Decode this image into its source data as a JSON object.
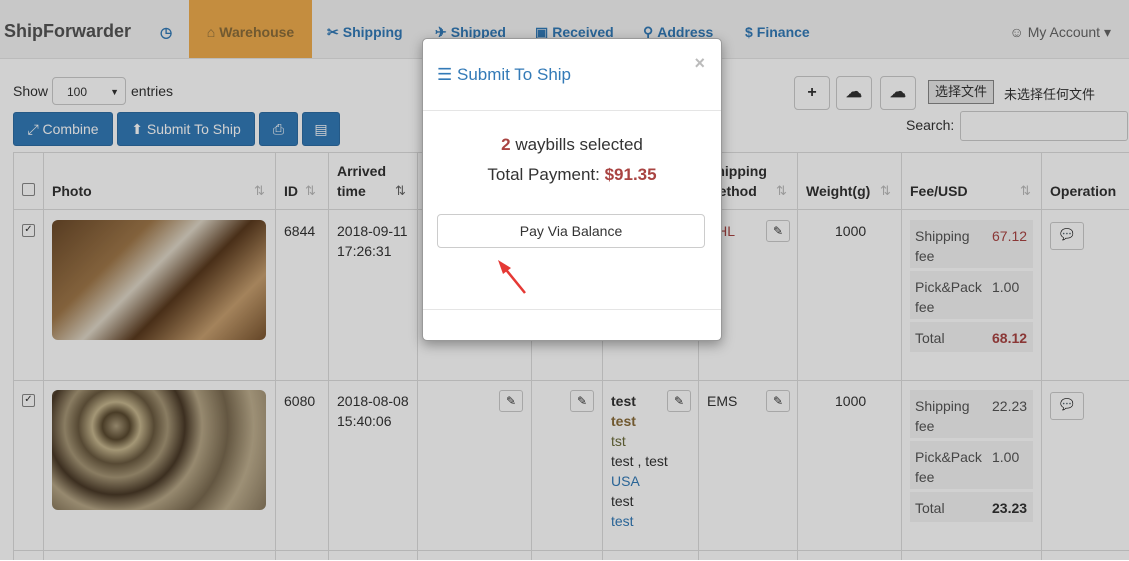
{
  "nav": {
    "brand": "ShipForwarder",
    "items": [
      {
        "label": "Warehouse",
        "icon": "home-icon",
        "glyph": "⌂"
      },
      {
        "label": "Shipping",
        "icon": "scissors-icon",
        "glyph": "✂"
      },
      {
        "label": "Shipped",
        "icon": "plane-icon",
        "glyph": "✈"
      },
      {
        "label": "Received",
        "icon": "calendar-check-icon",
        "glyph": "▣"
      },
      {
        "label": "Address",
        "icon": "map-marker-icon",
        "glyph": "⚲"
      },
      {
        "label": "Finance",
        "icon": "dollar-icon",
        "glyph": "$"
      }
    ],
    "history_glyph": "◷",
    "account": "My Account",
    "account_glyph": "☺",
    "account_caret": "▾"
  },
  "toolbar": {
    "show": "Show",
    "entries_value": "100",
    "entries": "entries",
    "combine": "Combine",
    "combine_glyph": "⤢",
    "submit": "Submit To Ship",
    "submit_glyph": "⬆",
    "print_glyph": "⎙",
    "excel_glyph": "▤",
    "add_glyph": "+",
    "download_glyph": "☁",
    "upload_glyph": "☁",
    "choose_file": "选择文件",
    "no_file": "未选择任何文件",
    "search": "Search:"
  },
  "table": {
    "headers": {
      "photo": "Photo",
      "id": "ID",
      "arrived_1": "Arrived",
      "arrived_2": "time",
      "method_1": "Shipping",
      "method_2": "Method",
      "weight": "Weight(g)",
      "fee": "Fee/USD",
      "operation": "Operation"
    },
    "rows": [
      {
        "id": "6844",
        "date": "2018-09-11",
        "time": "17:26:31",
        "method": "DHL",
        "weight": "1000",
        "shipping_fee_label_1": "Shipping",
        "shipping_fee_label_2": "fee",
        "shipping_fee": "67.12",
        "pick_label_1": "Pick&Pack",
        "pick_label_2": "fee",
        "pick_fee": "1.00",
        "total_label": "Total",
        "total": "68.12"
      },
      {
        "id": "6080",
        "date": "2018-08-08",
        "time": "15:40:06",
        "method": "EMS",
        "weight": "1000",
        "shipping_fee_label_1": "Shipping",
        "shipping_fee_label_2": "fee",
        "shipping_fee": "22.23",
        "pick_label_1": "Pick&Pack",
        "pick_label_2": "fee",
        "pick_fee": "1.00",
        "total_label": "Total",
        "total": "23.23",
        "address": [
          "test",
          "test",
          "tst",
          "test , test",
          "USA",
          "test",
          "test"
        ]
      }
    ],
    "pencil_glyph": "✎",
    "comment_glyph": "💬"
  },
  "modal": {
    "title": "Submit To Ship",
    "title_glyph": "☰",
    "close": "×",
    "count": "2",
    "selected_text": "waybills selected",
    "total_label": "Total Payment:",
    "total_value": "$91.35",
    "pay_button": "Pay Via Balance"
  }
}
